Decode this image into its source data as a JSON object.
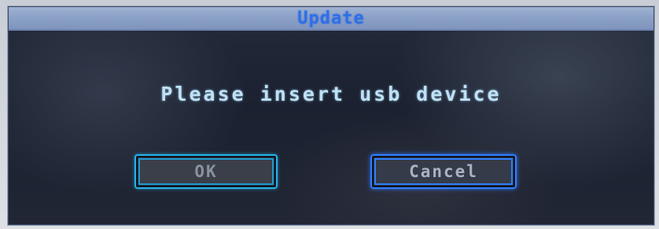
{
  "dialog": {
    "title": "Update",
    "message": "Please insert usb device",
    "buttons": {
      "ok_label": "OK",
      "cancel_label": "Cancel"
    }
  },
  "colors": {
    "title_text": "#2f6fe8",
    "message_text": "#bfe1f5",
    "button_border": "#25b4e6",
    "focused_button_border": "#2f7fff"
  }
}
